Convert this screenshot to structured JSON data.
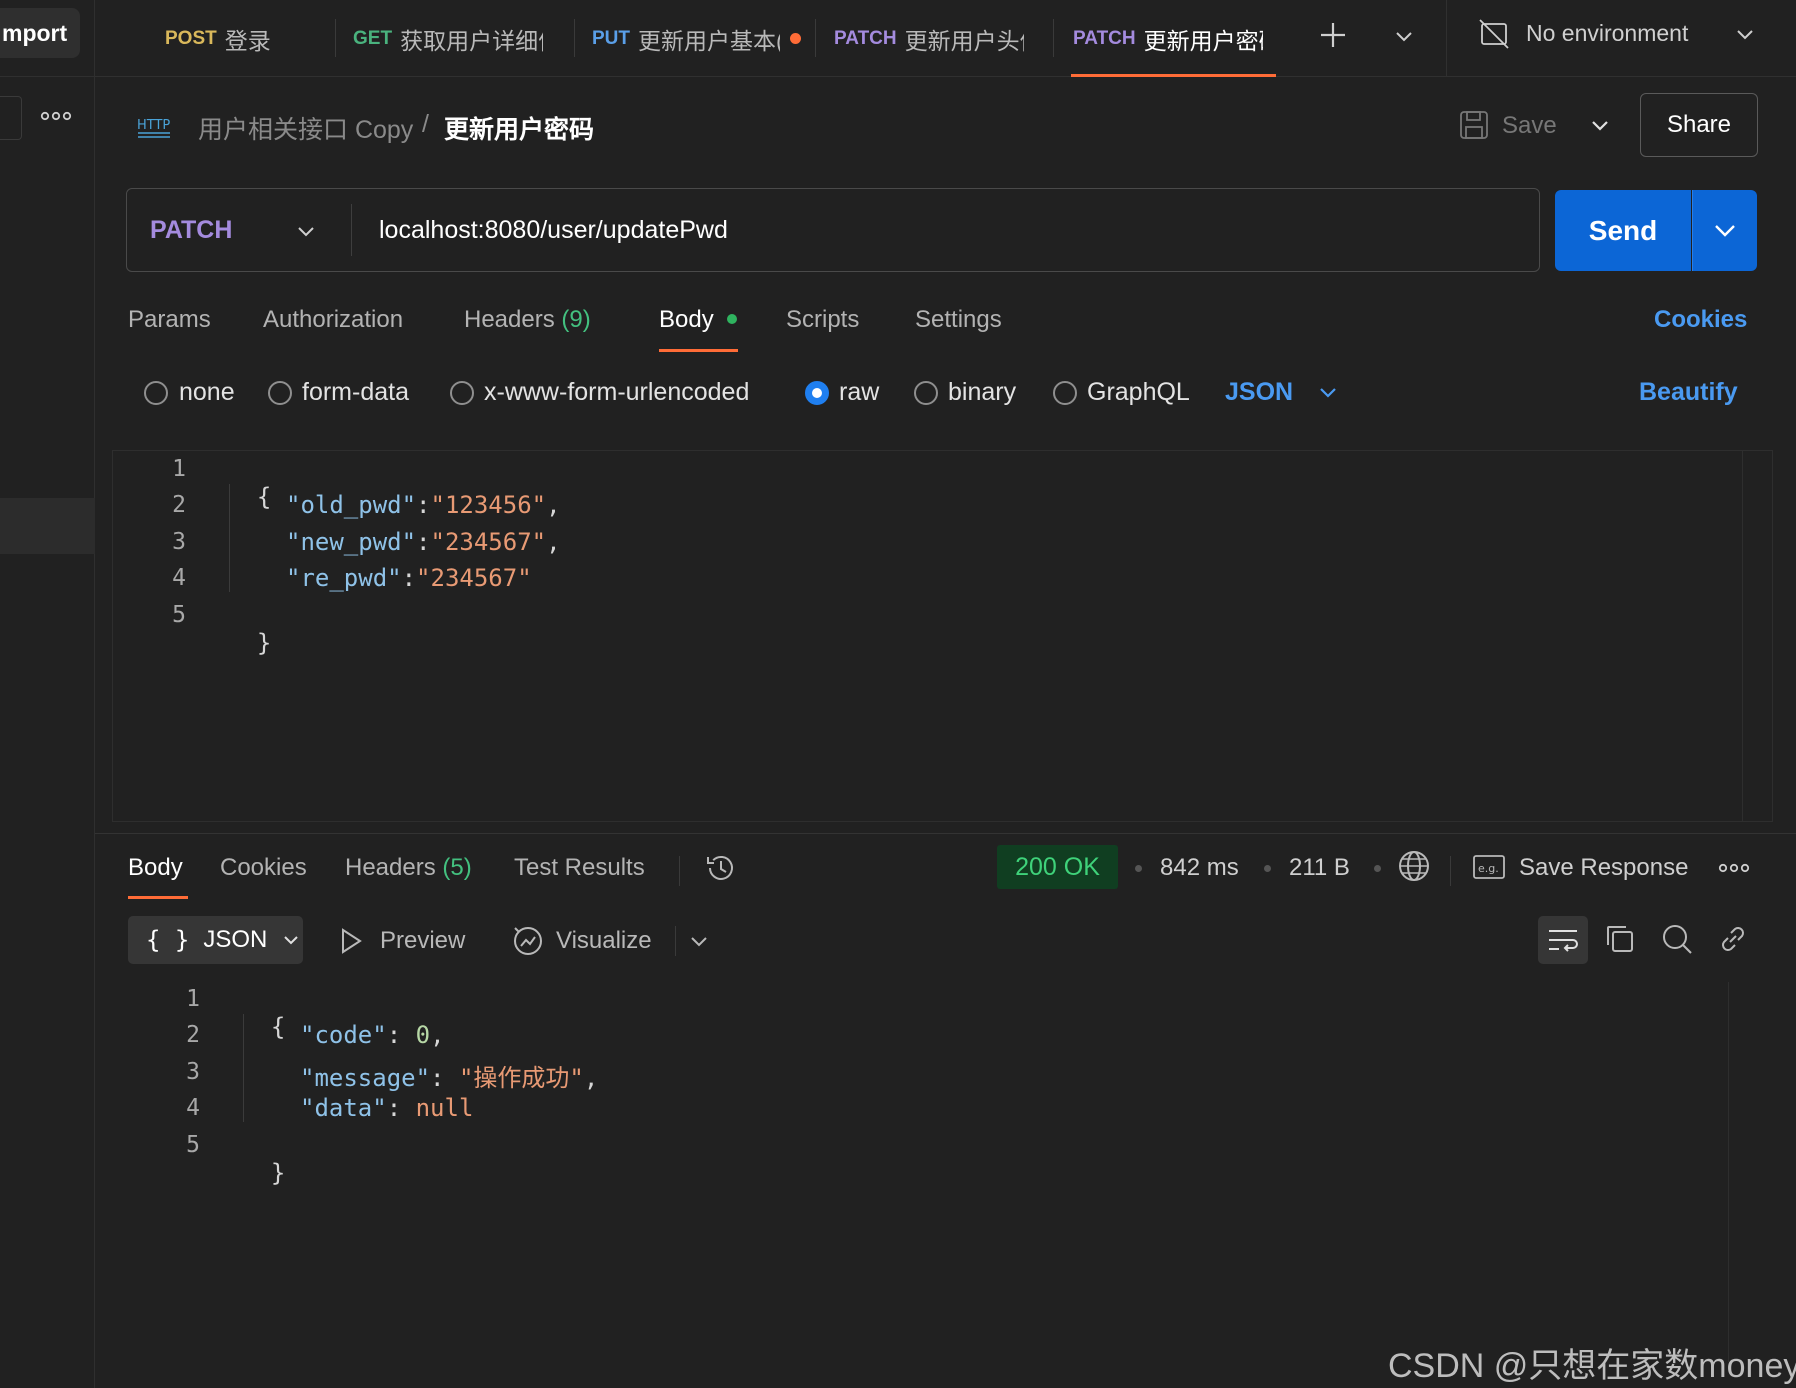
{
  "sidebar": {
    "import_label": "mport"
  },
  "tabs": [
    {
      "method": "POST",
      "method_color": "#d9b85b",
      "name": "登录"
    },
    {
      "method": "GET",
      "method_color": "#4ab37e",
      "name": "获取用户详细信"
    },
    {
      "method": "PUT",
      "method_color": "#5a9fe8",
      "name": "更新用户基本("
    },
    {
      "method": "PATCH",
      "method_color": "#a48bde",
      "name": "更新用户头像"
    },
    {
      "method": "PATCH",
      "method_color": "#a48bde",
      "name": "更新用户密码"
    }
  ],
  "environment": {
    "label": "No environment"
  },
  "breadcrumb": {
    "badge": "HTTP",
    "collection": "用户相关接口 Copy",
    "separator": "/",
    "request": "更新用户密码"
  },
  "actions": {
    "save_label": "Save",
    "share_label": "Share"
  },
  "request": {
    "method": "PATCH",
    "url": "localhost:8080/user/updatePwd",
    "send_label": "Send"
  },
  "request_tabs": {
    "params": "Params",
    "authorization": "Authorization",
    "headers": "Headers",
    "headers_count": "(9)",
    "body": "Body",
    "scripts": "Scripts",
    "settings": "Settings",
    "cookies": "Cookies"
  },
  "body_types": {
    "none": "none",
    "form_data": "form-data",
    "urlencoded": "x-www-form-urlencoded",
    "raw": "raw",
    "binary": "binary",
    "graphql": "GraphQL",
    "selected": "raw",
    "language": "JSON",
    "beautify": "Beautify"
  },
  "request_body": {
    "line_numbers": [
      "1",
      "2",
      "3",
      "4",
      "5"
    ],
    "open": "{",
    "close": "}",
    "fields": [
      {
        "key": "\"old_pwd\"",
        "value": "\"123456\"",
        "comma": ","
      },
      {
        "key": "\"new_pwd\"",
        "value": "\"234567\"",
        "comma": ","
      },
      {
        "key": "\"re_pwd\"",
        "value": "\"234567\"",
        "comma": ""
      }
    ]
  },
  "response_tabs": {
    "body": "Body",
    "cookies": "Cookies",
    "headers": "Headers",
    "headers_count": "(5)",
    "test_results": "Test Results"
  },
  "response_meta": {
    "status": "200 OK",
    "time": "842 ms",
    "size": "211 B",
    "save_response": "Save Response"
  },
  "response_toolbar": {
    "format_icon": "{ }",
    "format": "JSON",
    "preview": "Preview",
    "visualize": "Visualize"
  },
  "response_body": {
    "line_numbers": [
      "1",
      "2",
      "3",
      "4",
      "5"
    ],
    "open": "{",
    "close": "}",
    "code_key": "\"code\"",
    "code_value": "0",
    "message_key": "\"message\"",
    "message_value": "\"操作成功\"",
    "data_key": "\"data\"",
    "data_value": "null"
  },
  "watermark": "CSDN @只想在家数money"
}
